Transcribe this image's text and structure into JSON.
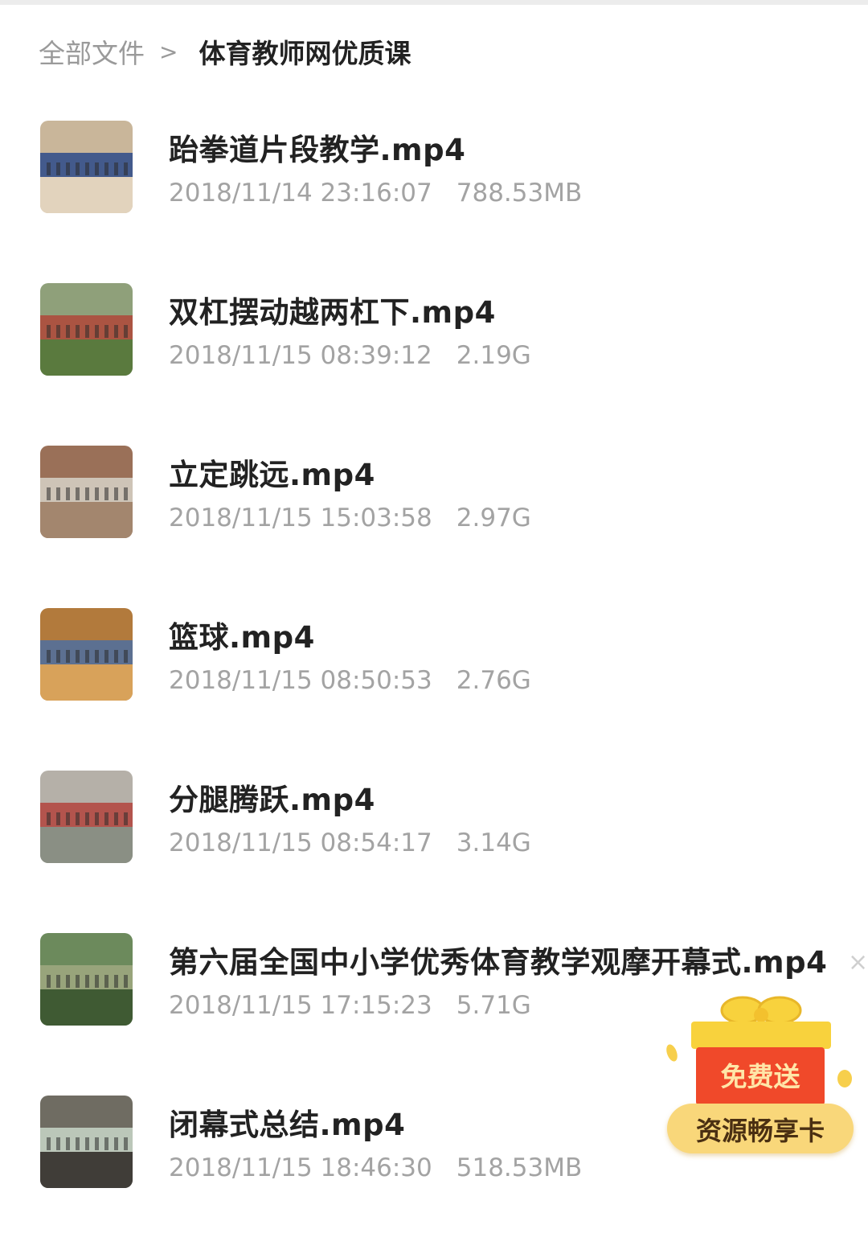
{
  "breadcrumb": {
    "root": "全部文件",
    "separator": ">",
    "current": "体育教师网优质课"
  },
  "files": [
    {
      "name": "跆拳道片段教学.mp4",
      "date": "2018/11/14 23:16:07",
      "size": "788.53MB",
      "thumb_colors": [
        "#c9b69a",
        "#2c4a8a",
        "#e2d3bd"
      ]
    },
    {
      "name": "双杠摆动越两杠下.mp4",
      "date": "2018/11/15 08:39:12",
      "size": "2.19G",
      "thumb_colors": [
        "#8fa07a",
        "#b04638",
        "#5a7a3e"
      ]
    },
    {
      "name": "立定跳远.mp4",
      "date": "2018/11/15 15:03:58",
      "size": "2.97G",
      "thumb_colors": [
        "#9a7058",
        "#d7d2c8",
        "#a3866e"
      ]
    },
    {
      "name": "篮球.mp4",
      "date": "2018/11/15 08:50:53",
      "size": "2.76G",
      "thumb_colors": [
        "#b27a3c",
        "#4c6ea0",
        "#d8a25a"
      ]
    },
    {
      "name": "分腿腾跃.mp4",
      "date": "2018/11/15 08:54:17",
      "size": "3.14G",
      "thumb_colors": [
        "#b5b0a8",
        "#b3443d",
        "#8a8f84"
      ]
    },
    {
      "name": "第六届全国中小学优秀体育教学观摩开幕式.mp4",
      "date": "2018/11/15 17:15:23",
      "size": "5.71G",
      "thumb_colors": [
        "#6c8a5c",
        "#a0a880",
        "#3f5a33"
      ]
    },
    {
      "name": "闭幕式总结.mp4",
      "date": "2018/11/15 18:46:30",
      "size": "518.53MB",
      "thumb_colors": [
        "#6f6c62",
        "#c9d7c9",
        "#403d38"
      ]
    }
  ],
  "promo": {
    "free_label": "免费送",
    "card_label": "资源畅享卡",
    "close_icon": "×",
    "colors": {
      "box": "#f0492a",
      "lid": "#f8d23d",
      "pill": "#f9d77a"
    }
  }
}
